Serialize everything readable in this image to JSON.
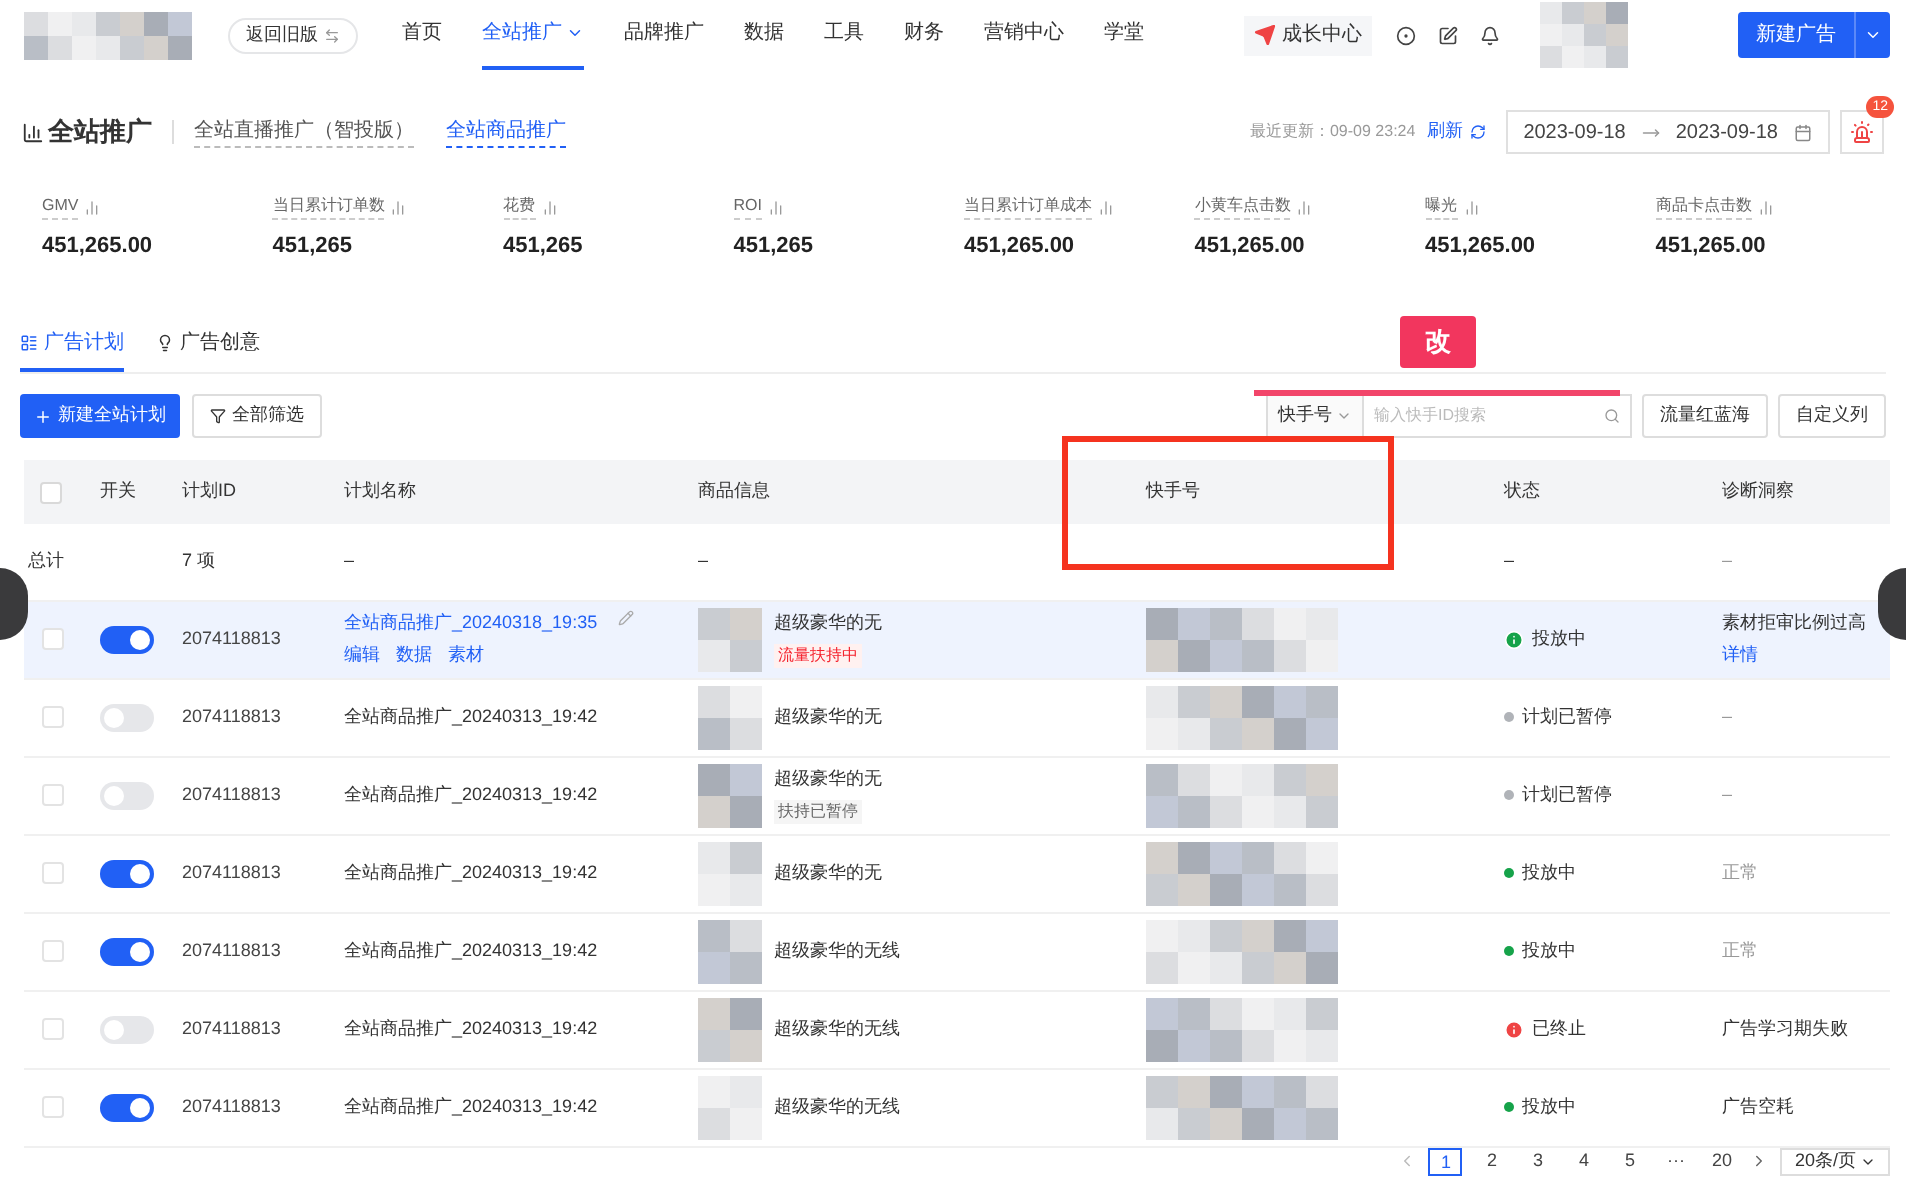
{
  "top_nav": {
    "back_button": "返回旧版",
    "items": [
      {
        "label": "首页",
        "selected": false,
        "has_menu": false
      },
      {
        "label": "全站推广",
        "selected": true,
        "has_menu": true
      },
      {
        "label": "品牌推广",
        "selected": false,
        "has_menu": false
      },
      {
        "label": "数据",
        "selected": false,
        "has_menu": false
      },
      {
        "label": "工具",
        "selected": false,
        "has_menu": false
      },
      {
        "label": "财务",
        "selected": false,
        "has_menu": false
      },
      {
        "label": "营销中心",
        "selected": false,
        "has_menu": false
      },
      {
        "label": "学堂",
        "selected": false,
        "has_menu": false
      }
    ],
    "growth_center": "成长中心",
    "create_button": "新建广告"
  },
  "header": {
    "title": "全站推广",
    "tabs": [
      {
        "label": "全站直播推广（智投版）",
        "selected": false
      },
      {
        "label": "全站商品推广",
        "selected": true
      }
    ],
    "last_updated": "最近更新：09-09 23:24",
    "refresh": "刷新",
    "date_start": "2023-09-18",
    "date_end": "2023-09-18",
    "alert_badge": "12"
  },
  "metrics": [
    {
      "label": "GMV",
      "value": "451,265.00"
    },
    {
      "label": "当日累计订单数",
      "value": "451,265"
    },
    {
      "label": "花费",
      "value": "451,265"
    },
    {
      "label": "ROI",
      "value": "451,265"
    },
    {
      "label": "当日累计订单成本",
      "value": "451,265.00"
    },
    {
      "label": "小黄车点击数",
      "value": "451,265.00"
    },
    {
      "label": "曝光",
      "value": "451,265.00"
    },
    {
      "label": "商品卡点击数",
      "value": "451,265.00"
    }
  ],
  "content_tabs": [
    {
      "label": "广告计划",
      "selected": true
    },
    {
      "label": "广告创意",
      "selected": false
    }
  ],
  "toolbar": {
    "create_button": "新建全站计划",
    "filter_button": "全部筛选",
    "search_type": "快手号",
    "search_placeholder": "输入快手ID搜索",
    "buttons": [
      "流量红蓝海",
      "自定义列"
    ]
  },
  "annotation": {
    "label": "改"
  },
  "table": {
    "select_all_checked": false,
    "columns": [
      "开关",
      "计划ID",
      "计划名称",
      "商品信息",
      "快手号",
      "状态",
      "诊断洞察"
    ],
    "summary": {
      "label": "总计",
      "count": "7 项",
      "name": "–",
      "product": "–",
      "status": "–",
      "diagnosis": "–"
    },
    "rows": [
      {
        "selected": true,
        "checked": false,
        "on": true,
        "id": "2074118813",
        "name": "全站商品推广_20240318_19:35",
        "actions": [
          "编辑",
          "数据",
          "素材"
        ],
        "product": "超级豪华的无",
        "tag": {
          "text": "流量扶持中",
          "kind": "active"
        },
        "status": {
          "text": "投放中",
          "kind": "running",
          "icon": true
        },
        "diagnosis": {
          "text": "素材拒审比例过高",
          "kind": "issue",
          "link": "详情"
        }
      },
      {
        "selected": false,
        "checked": false,
        "on": false,
        "id": "2074118813",
        "name": "全站商品推广_20240313_19:42",
        "product": "超级豪华的无",
        "status": {
          "text": "计划已暂停",
          "kind": "paused",
          "icon": false
        },
        "diagnosis": {
          "text": "–",
          "kind": "none"
        }
      },
      {
        "selected": false,
        "checked": false,
        "on": false,
        "id": "2074118813",
        "name": "全站商品推广_20240313_19:42",
        "product": "超级豪华的无",
        "tag": {
          "text": "扶持已暂停",
          "kind": "paused"
        },
        "status": {
          "text": "计划已暂停",
          "kind": "paused",
          "icon": false
        },
        "diagnosis": {
          "text": "–",
          "kind": "none"
        }
      },
      {
        "selected": false,
        "checked": false,
        "on": true,
        "id": "2074118813",
        "name": "全站商品推广_20240313_19:42",
        "product": "超级豪华的无",
        "status": {
          "text": "投放中",
          "kind": "running",
          "icon": false
        },
        "diagnosis": {
          "text": "正常",
          "kind": "normal"
        }
      },
      {
        "selected": false,
        "checked": false,
        "on": true,
        "id": "2074118813",
        "name": "全站商品推广_20240313_19:42",
        "product": "超级豪华的无线",
        "status": {
          "text": "投放中",
          "kind": "running",
          "icon": false
        },
        "diagnosis": {
          "text": "正常",
          "kind": "normal"
        }
      },
      {
        "selected": false,
        "checked": false,
        "on": false,
        "id": "2074118813",
        "name": "全站商品推广_20240313_19:42",
        "product": "超级豪华的无线",
        "status": {
          "text": "已终止",
          "kind": "ended",
          "icon": true
        },
        "diagnosis": {
          "text": "广告学习期失败",
          "kind": "issue"
        }
      },
      {
        "selected": false,
        "checked": false,
        "on": true,
        "id": "2074118813",
        "name": "全站商品推广_20240313_19:42",
        "product": "超级豪华的无线",
        "status": {
          "text": "投放中",
          "kind": "running",
          "icon": false
        },
        "diagnosis": {
          "text": "广告空耗",
          "kind": "issue"
        }
      }
    ]
  },
  "pagination": {
    "pages": [
      {
        "label": "1",
        "selected": true
      },
      {
        "label": "2",
        "selected": false
      },
      {
        "label": "3",
        "selected": false
      },
      {
        "label": "4",
        "selected": false
      },
      {
        "label": "5",
        "selected": false
      },
      {
        "label": "···",
        "selected": false
      },
      {
        "label": "20",
        "selected": false
      }
    ],
    "page_size": "20条/页"
  }
}
